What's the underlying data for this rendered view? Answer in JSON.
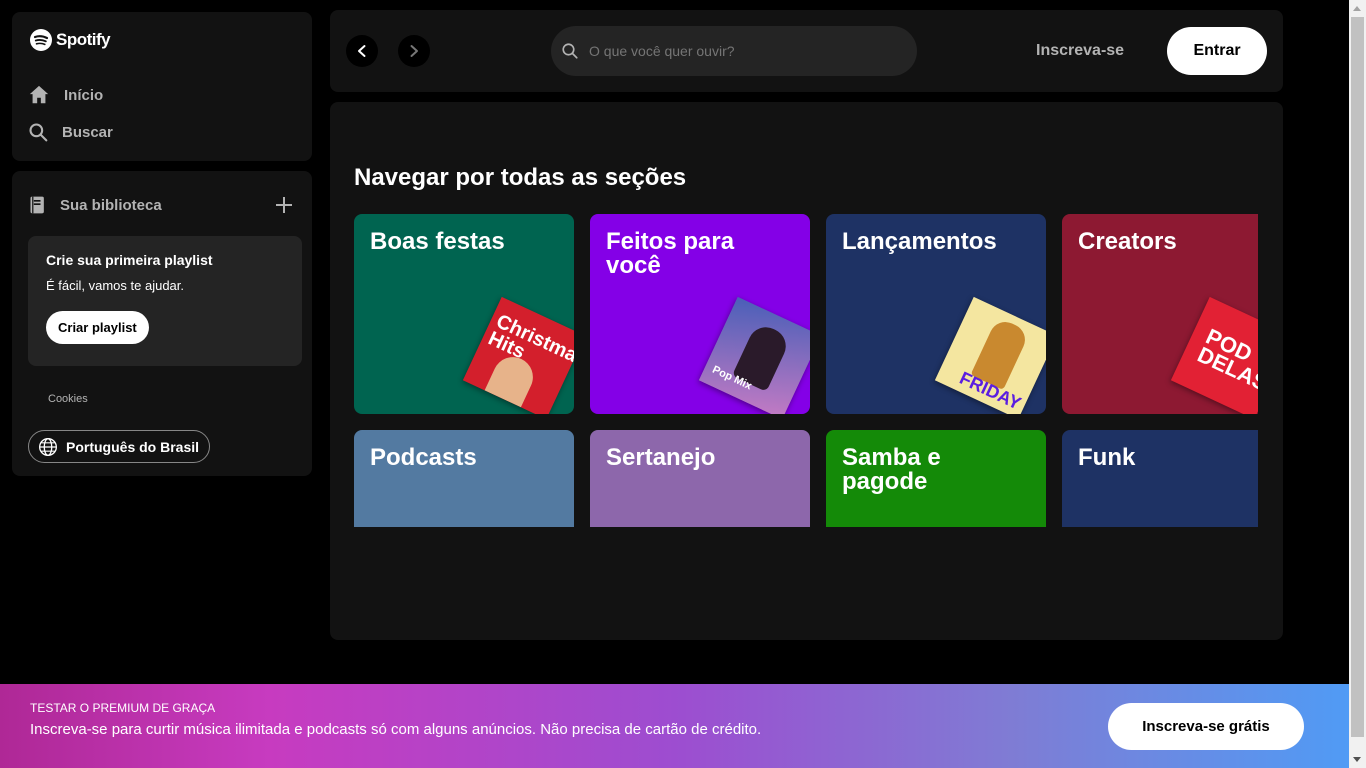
{
  "sidebar": {
    "logo_text": "Spotify",
    "nav": [
      {
        "label": "Início",
        "icon": "home-icon"
      },
      {
        "label": "Buscar",
        "icon": "search-icon"
      }
    ]
  },
  "library": {
    "title": "Sua biblioteca",
    "promo": {
      "title": "Crie sua primeira playlist",
      "subtitle": "É fácil, vamos te ajudar.",
      "button": "Criar playlist"
    },
    "cookies": "Cookies",
    "language": "Português do Brasil"
  },
  "topbar": {
    "search_placeholder": "O que você quer ouvir?",
    "signup": "Inscreva-se",
    "login": "Entrar"
  },
  "main": {
    "section_title": "Navegar por todas as seções",
    "cards": [
      {
        "title": "Boas festas",
        "color": "#006450",
        "art_text": "Christmas Hits",
        "art_color": "#d31f2c"
      },
      {
        "title": "Feitos para você",
        "color": "#8400e7",
        "art_text": "Pop Mix",
        "art_color": "#2b3f8a"
      },
      {
        "title": "Lançamentos",
        "color": "#1e3264",
        "art_text": "FRIDAY",
        "art_color": "#f4e6a0"
      },
      {
        "title": "Creators",
        "color": "#8d1932",
        "art_text": "POD DELAS",
        "art_color": "#e22134"
      },
      {
        "title": "Podcasts",
        "color": "#537aa1"
      },
      {
        "title": "Sertanejo",
        "color": "#8d67ab"
      },
      {
        "title": "Samba e pagode",
        "color": "#148a08"
      },
      {
        "title": "Funk",
        "color": "#1e3264"
      }
    ]
  },
  "banner": {
    "kicker": "TESTAR O PREMIUM DE GRAÇA",
    "text": "Inscreva-se para curtir música ilimitada e podcasts só com alguns anúncios. Não precisa de cartão de crédito.",
    "button": "Inscreva-se grátis"
  }
}
